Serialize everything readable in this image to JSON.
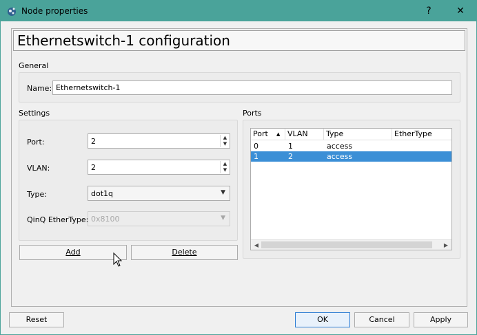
{
  "window": {
    "title": "Node properties",
    "help_glyph": "?",
    "close_glyph": "✕",
    "accent": "#4aa39a"
  },
  "header": {
    "title": "Ethernetswitch-1 configuration"
  },
  "general": {
    "label": "General",
    "name_label": "Name:",
    "name_value": "Ethernetswitch-1"
  },
  "settings": {
    "label": "Settings",
    "port_label": "Port:",
    "port_value": "2",
    "vlan_label": "VLAN:",
    "vlan_value": "2",
    "type_label": "Type:",
    "type_value": "dot1q",
    "qinq_label": "QinQ EtherType:",
    "qinq_value": "0x8100",
    "add_label": "Add",
    "delete_label": "Delete"
  },
  "ports": {
    "label": "Ports",
    "columns": [
      "Port",
      "VLAN",
      "Type",
      "EtherType"
    ],
    "rows": [
      {
        "port": "0",
        "vlan": "1",
        "type": "access",
        "ethertype": ""
      },
      {
        "port": "1",
        "vlan": "2",
        "type": "access",
        "ethertype": ""
      }
    ],
    "selected_row": 1,
    "selection_color": "#3b8fd6"
  },
  "footer": {
    "reset_label": "Reset",
    "ok_label": "OK",
    "cancel_label": "Cancel",
    "apply_label": "Apply"
  }
}
